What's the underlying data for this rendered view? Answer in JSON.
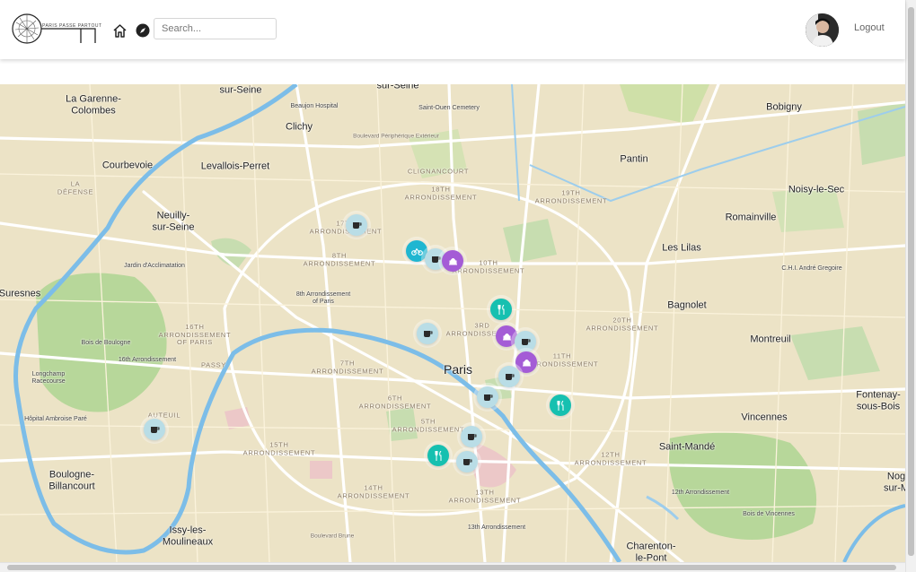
{
  "header": {
    "logo_text": "PARIS PASSE PARTOUT",
    "search_placeholder": "Search...",
    "logout_label": "Logout",
    "icons": {
      "home": "home-icon",
      "explore": "compass-icon",
      "avatar": "user-avatar"
    }
  },
  "map": {
    "labels": {
      "sur_seine_w": "sur-Seine",
      "sur_seine_n": "sur-Seine",
      "beaujon": "Beaujon Hospital",
      "st_ouen": "Saint-Ouen Cemetery",
      "la_garenne": "La Garenne-\nColombes",
      "bobigny": "Bobigny",
      "clichy": "Clichy",
      "periph": "Boulevard Périphérique Extérieur",
      "pantin": "Pantin",
      "courbevoie": "Courbevoie",
      "levallois": "Levallois-Perret",
      "clignancourt": "CLIGNANCOURT",
      "arr18": "18TH\nARRONDISSEMENT",
      "arr19": "19TH\nARRONDISSEMENT",
      "ladefense": "LA\nDÉFENSE",
      "noisy": "Noisy-le-Sec",
      "neuilly": "Neuilly-\nsur-Seine",
      "romainville": "Romainville",
      "arr17": "17TH\nARRONDISSEMENT",
      "leslilas": "Les Lilas",
      "arr8": "8TH\nARRONDISSEMENT",
      "arr10": "10TH\nARRONDISSEMENT",
      "jardin": "Jardin d'Acclimatation",
      "chu": "C.H.I. André Gregoire",
      "suresnes": "Suresnes",
      "arr8b": "8th Arrondissement\nof Paris",
      "bagnolet": "Bagnolet",
      "arr20": "20TH\nARRONDISSEMENT",
      "arr16": "16TH\nARRONDISSEMENT\nOF PARIS",
      "arr3": "3RD\nARRONDISSEMENT",
      "bois_boulogne": "Bois de Boulogne",
      "montreuil": "Montreuil",
      "arr16b": "16th Arrondissement",
      "passy": "PASSY",
      "arr11": "11TH\nARRONDISSEMENT",
      "arr7": "7TH\nARRONDISSEMENT",
      "paris": "Paris",
      "longchamp": "Longchamp\nRacecourse",
      "fontenay": "Fontenay-\nsous-Bois",
      "arr6": "6TH\nARRONDISSEMENT",
      "hopital": "Hôpital Ambroise Paré",
      "auteuil": "AUTEUIL",
      "vincennes": "Vincennes",
      "arr5": "5TH\nARRONDISSEMENT",
      "saintmande": "Saint-Mandé",
      "arr15": "15TH\nARRONDISSEMENT",
      "arr12": "12TH\nARRONDISSEMENT",
      "boulogne": "Boulogne-\nBillancourt",
      "arr14": "14TH\nARRONDISSEMENT",
      "arr12b": "12th Arrondissement",
      "noisy2": "Nog\nsur-M",
      "arr13": "13TH\nARRONDISSEMENT",
      "bois_vincennes": "Bois de Vincennes",
      "issy": "Issy-les-\nMoulineaux",
      "arr13b": "13th Arrondissement",
      "charenton": "Charenton-\nle-Pont",
      "bd_peri": "Boulevard Brune"
    },
    "markers": [
      {
        "kind": "cafe",
        "color": "#b9dde6",
        "icon": "coffee-icon"
      },
      {
        "kind": "bike",
        "color": "#1fb6d1",
        "icon": "bicycle-icon"
      },
      {
        "kind": "cafe",
        "color": "#b9dde6",
        "icon": "coffee-icon"
      },
      {
        "kind": "landmark",
        "color": "#a45cd6",
        "icon": "monument-icon"
      },
      {
        "kind": "restaurant",
        "color": "#16c0b0",
        "icon": "utensils-icon"
      },
      {
        "kind": "cafe",
        "color": "#b9dde6",
        "icon": "coffee-icon"
      },
      {
        "kind": "landmark",
        "color": "#a45cd6",
        "icon": "monument-icon"
      },
      {
        "kind": "cafe",
        "color": "#b9dde6",
        "icon": "coffee-icon"
      },
      {
        "kind": "landmark",
        "color": "#a45cd6",
        "icon": "monument-icon"
      },
      {
        "kind": "cafe",
        "color": "#b9dde6",
        "icon": "coffee-icon"
      },
      {
        "kind": "cafe",
        "color": "#b9dde6",
        "icon": "coffee-icon"
      },
      {
        "kind": "restaurant",
        "color": "#16c0b0",
        "icon": "utensils-icon"
      },
      {
        "kind": "cafe",
        "color": "#b9dde6",
        "icon": "coffee-icon"
      },
      {
        "kind": "cafe",
        "color": "#b9dde6",
        "icon": "coffee-icon"
      },
      {
        "kind": "restaurant",
        "color": "#16c0b0",
        "icon": "utensils-icon"
      },
      {
        "kind": "cafe",
        "color": "#b9dde6",
        "icon": "coffee-icon"
      }
    ]
  }
}
